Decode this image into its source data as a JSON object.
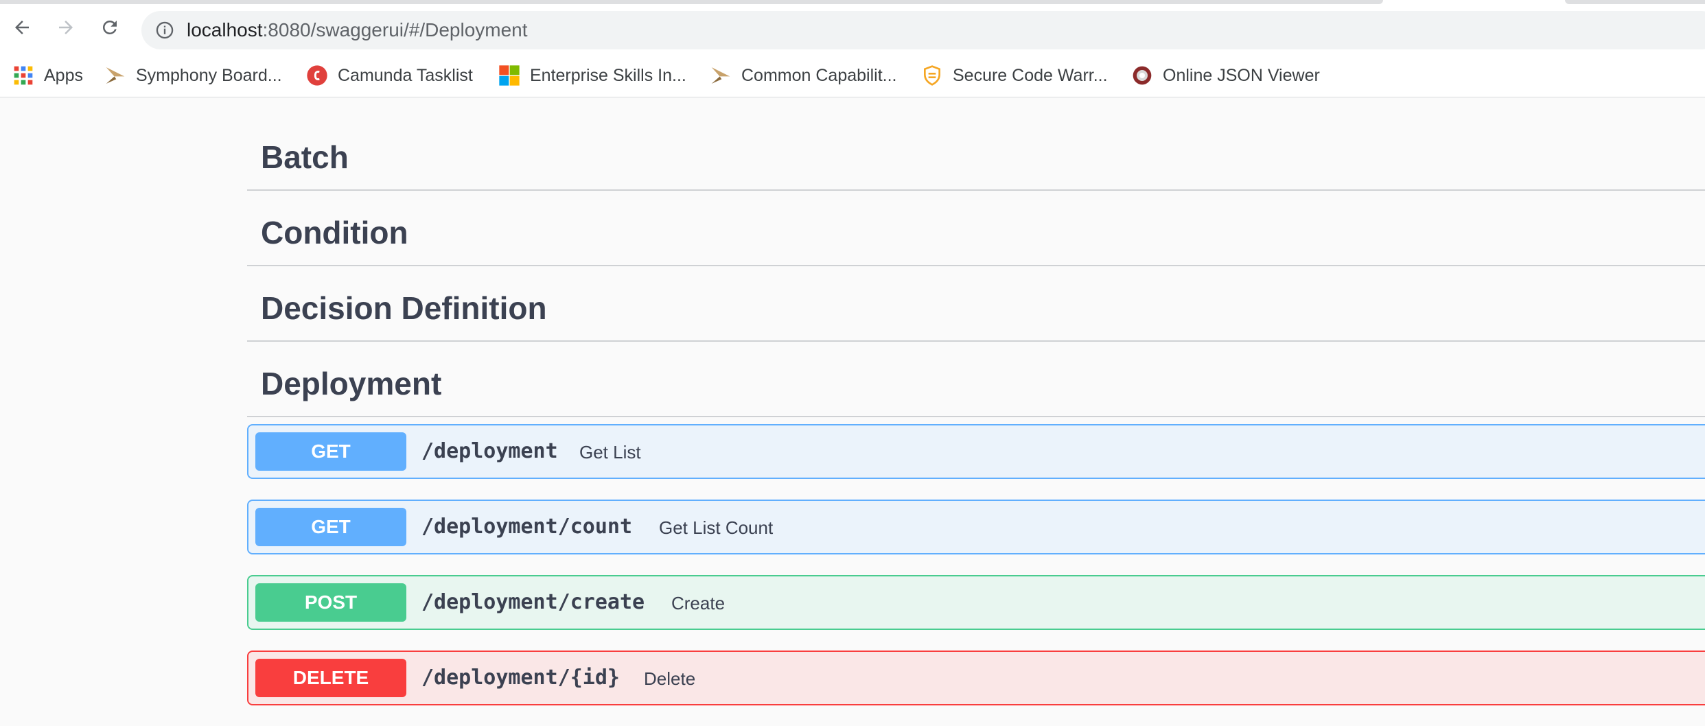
{
  "browser": {
    "url_host": "localhost",
    "url_rest": ":8080/swaggerui/#/Deployment"
  },
  "bookmarks": [
    {
      "label": "Apps",
      "icon": "apps-grid-icon"
    },
    {
      "label": "Symphony Board...",
      "icon": "symphony-icon"
    },
    {
      "label": "Camunda Tasklist",
      "icon": "camunda-icon"
    },
    {
      "label": "Enterprise Skills In...",
      "icon": "microsoft-icon"
    },
    {
      "label": "Common Capabilit...",
      "icon": "symphony-icon"
    },
    {
      "label": "Secure Code Warr...",
      "icon": "shield-icon"
    },
    {
      "label": "Online JSON Viewer",
      "icon": "json-viewer-icon"
    }
  ],
  "tags": [
    "Batch",
    "Condition",
    "Decision Definition",
    "Deployment"
  ],
  "operations": [
    {
      "method": "GET",
      "path": "/deployment",
      "summary": "Get List"
    },
    {
      "method": "GET",
      "path": "/deployment/count",
      "summary": "Get List Count"
    },
    {
      "method": "POST",
      "path": "/deployment/create",
      "summary": "Create"
    },
    {
      "method": "DELETE",
      "path": "/deployment/{id}",
      "summary": "Delete"
    }
  ],
  "colors": {
    "get": "#61affe",
    "post": "#49cc90",
    "delete": "#f93e3e",
    "heading": "#3b4151"
  }
}
